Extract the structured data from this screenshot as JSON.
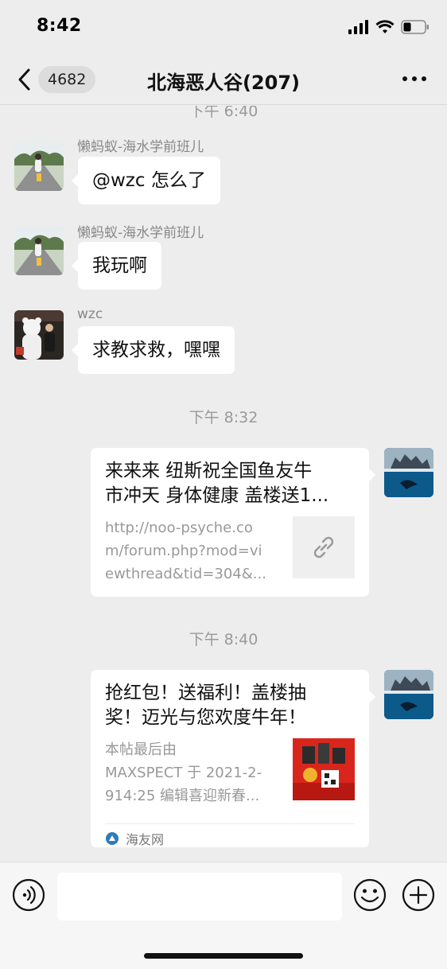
{
  "status": {
    "time": "8:42"
  },
  "header": {
    "unread_count": "4682",
    "title": "北海恶人谷(207)"
  },
  "messages": [
    {
      "type": "timestamp",
      "text": "下午 6:40"
    },
    {
      "type": "text",
      "sender": "懒蚂蚁-海水学前班儿",
      "text": "@wzc 怎么了"
    },
    {
      "type": "text",
      "sender": "懒蚂蚁-海水学前班儿",
      "text": "我玩啊"
    },
    {
      "type": "text",
      "sender": "wzc",
      "text": "求教求救，嘿嘿"
    },
    {
      "type": "timestamp",
      "text": "下午 8:32"
    },
    {
      "type": "link_card",
      "title_line1": "来来来 纽斯祝全国鱼友牛",
      "title_line2": "市冲天 身体健康 盖楼送1...",
      "desc_line1": "http://noo-psyche.co",
      "desc_line2": "m/forum.php?mod=vi",
      "desc_line3": "ewthread&tid=304&..."
    },
    {
      "type": "timestamp",
      "text": "下午 8:40"
    },
    {
      "type": "link_card",
      "title_line1": "抢红包！送福利！盖楼抽",
      "title_line2": "奖！迈光与您欢度牛年！",
      "desc_line1": "本帖最后由",
      "desc_line2": "MAXSPECT 于 2021-2-",
      "desc_line3": "914:25 编辑喜迎新春...",
      "source": "海友网"
    }
  ],
  "icons": {
    "back": "chevron-left-icon",
    "more": "more-dots-icon",
    "voice": "voice-icon",
    "emoji": "emoji-icon",
    "add": "plus-circle-icon",
    "link": "link-icon",
    "source": "source-logo-icon"
  },
  "colors": {
    "background": "#ededed",
    "bubble": "#ffffff",
    "timestamp": "#9a9a9a"
  }
}
